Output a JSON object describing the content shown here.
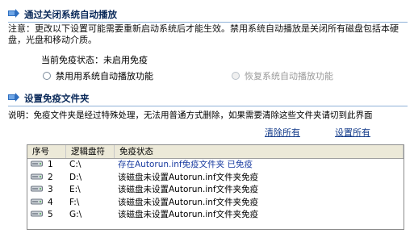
{
  "autoplay_section": {
    "title": "通过关闭系统自动播放",
    "note": "注意：更改以下设置可能需要重新启动系统后才能生效。禁用系统自动播放是关闭所有磁盘包括本硬盘，光盘和移动介质。",
    "status": "当前免疫状态：未启用免疫",
    "option_disable": "禁用用系统自动播放功能",
    "option_restore": "恢复系统自动播放功能"
  },
  "folder_section": {
    "title": "设置免疫文件夹",
    "description": "说明：免疫文件夹是经过特殊处理，无法用普通方式删除，如果需要清除这些文件夹请切到此界面",
    "clear_all": "清除所有",
    "set_all": "设置所有"
  },
  "table": {
    "headers": [
      "序号",
      "逻辑盘符",
      "免疫状态"
    ],
    "rows": [
      {
        "index": "1",
        "drive": "C:\\",
        "status": "存在Autorun.inf免疫文件夹 已免疫"
      },
      {
        "index": "2",
        "drive": "D:\\",
        "status": "该磁盘未设置Autorun.inf文件夹免疫"
      },
      {
        "index": "3",
        "drive": "E:\\",
        "status": "该磁盘未设置Autorun.inf文件夹免疫"
      },
      {
        "index": "4",
        "drive": "F:\\",
        "status": "该磁盘未设置Autorun.inf文件夹免疫"
      },
      {
        "index": "5",
        "drive": "G:\\",
        "status": "该磁盘未设置Autorun.inf文件夹免疫"
      }
    ]
  },
  "icons": {
    "section": "shield-arrow-icon",
    "drive": "hard-drive-icon"
  },
  "colors": {
    "section_title": "#0b2a5a",
    "divider": "#8fb2d8",
    "link": "#123a8a",
    "header_bg": "#ece9d8"
  }
}
